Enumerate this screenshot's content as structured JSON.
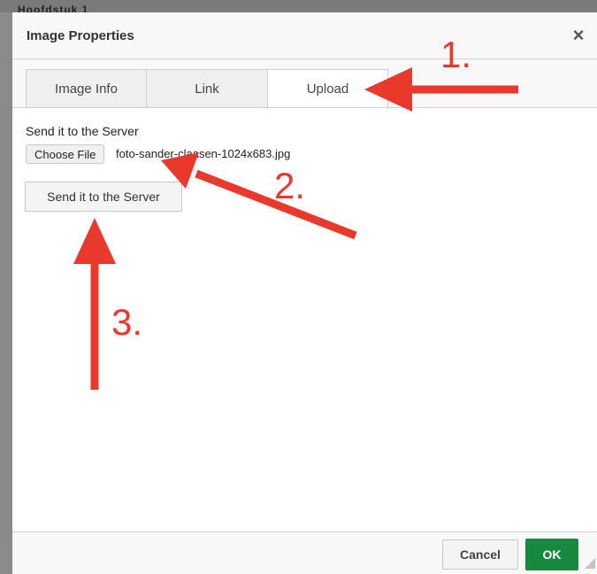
{
  "background": {
    "header_fragment": "Hoofdstuk 1"
  },
  "dialog": {
    "title": "Image Properties",
    "close_icon": "close-icon",
    "tabs": [
      {
        "label": "Image Info",
        "active": false
      },
      {
        "label": "Link",
        "active": false
      },
      {
        "label": "Upload",
        "active": true
      }
    ],
    "upload": {
      "label": "Send it to the Server",
      "choose_file_label": "Choose File",
      "file_name": "foto-sander-claasen-1024x683.jpg",
      "send_button_label": "Send it to the Server"
    },
    "footer": {
      "cancel_label": "Cancel",
      "ok_label": "OK"
    }
  },
  "annotations": {
    "step1": "1.",
    "step2": "2.",
    "step3": "3."
  },
  "colors": {
    "ok_button": "#178a3f",
    "annotation_red": "#e8392c",
    "title_bar": "#f8f8f8"
  }
}
